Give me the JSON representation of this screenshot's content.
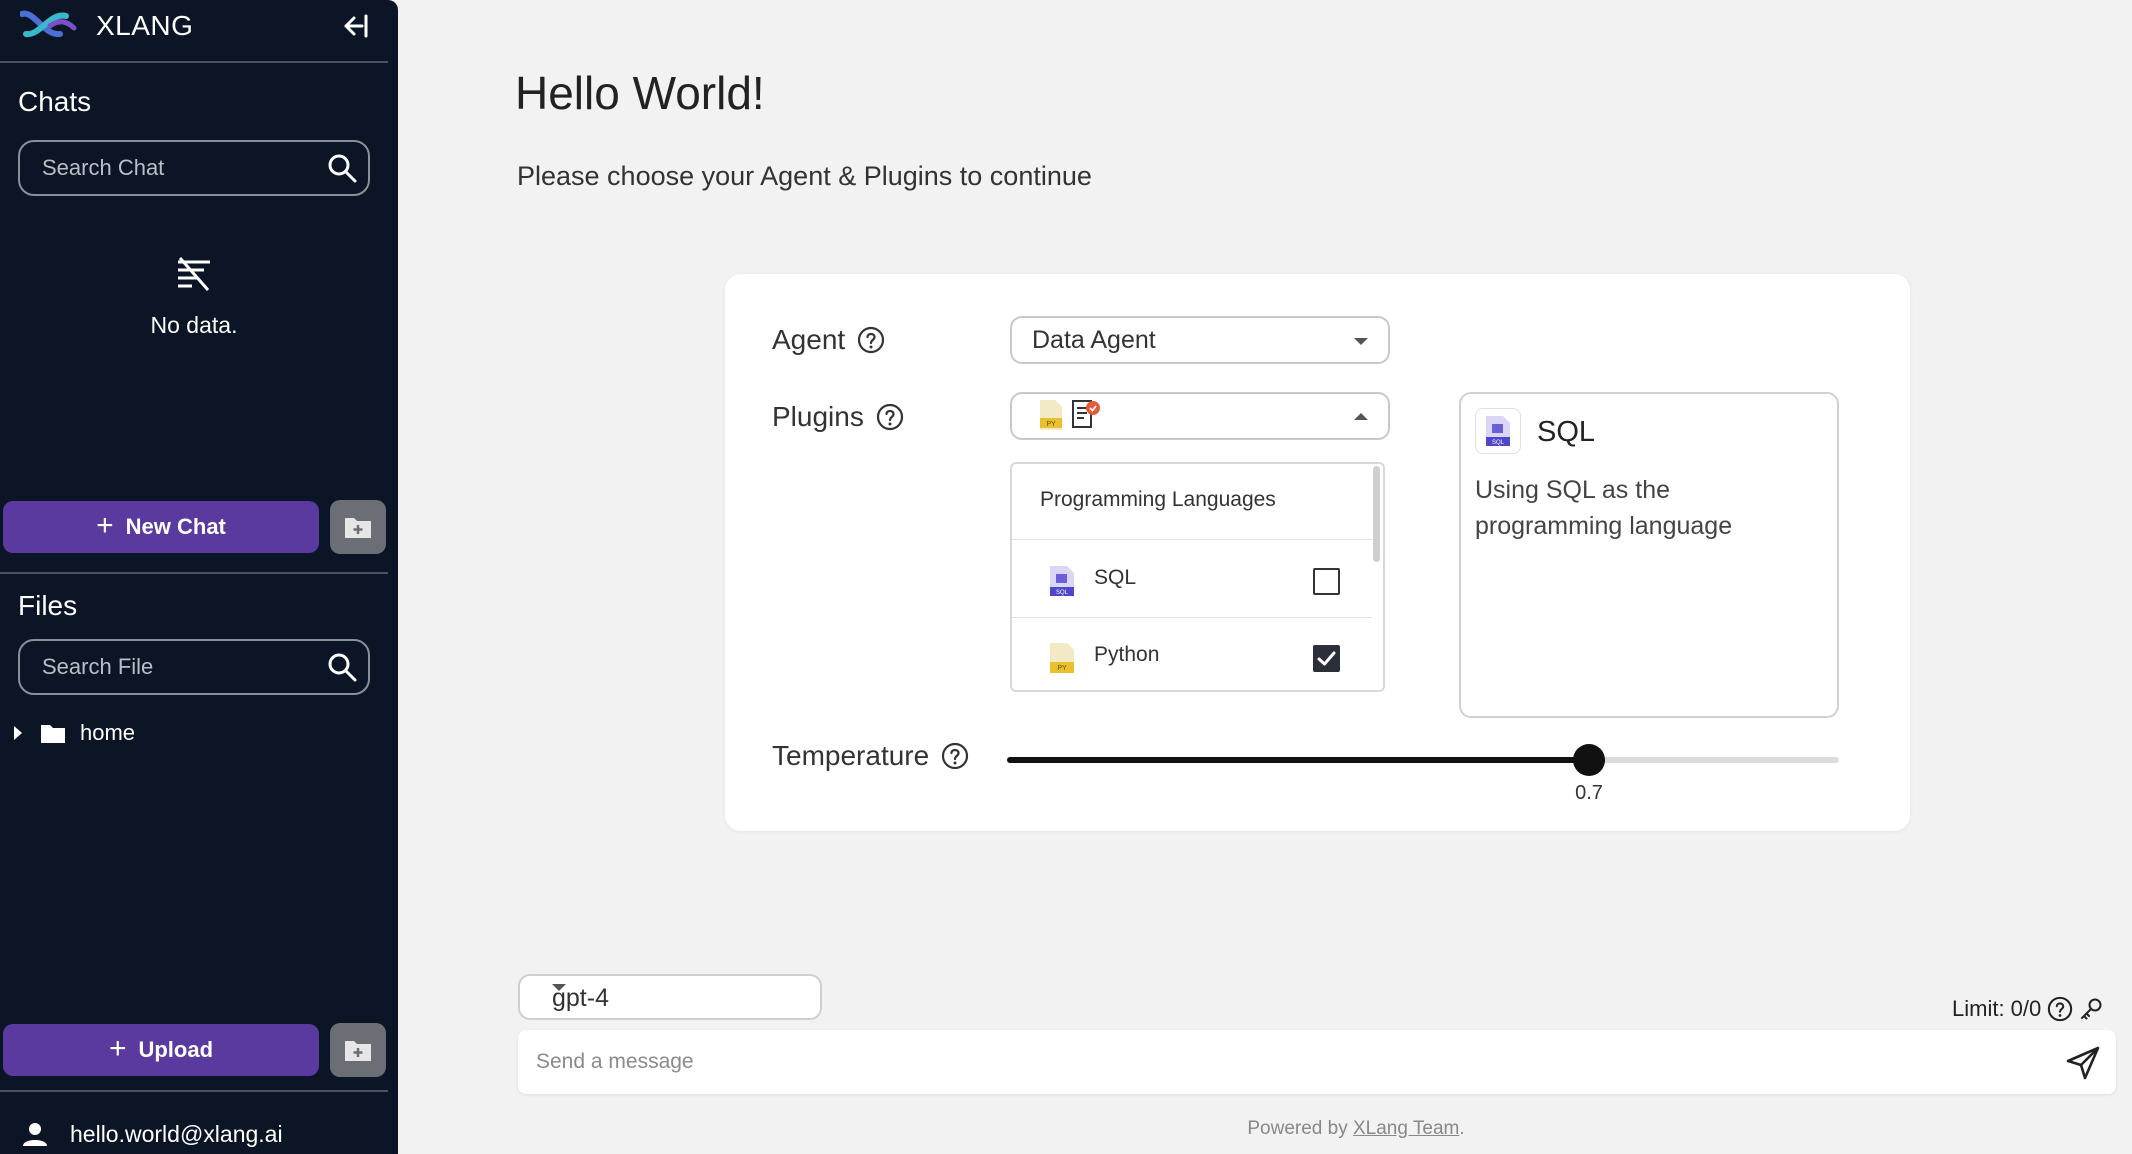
{
  "sidebar": {
    "brand": "XLANG",
    "chats_title": "Chats",
    "search_chat_placeholder": "Search Chat",
    "empty_text": "No data.",
    "new_chat_label": "New Chat",
    "files_title": "Files",
    "search_file_placeholder": "Search File",
    "folder": "home",
    "upload_label": "Upload",
    "user_email": "hello.world@xlang.ai"
  },
  "main": {
    "title": "Hello World!",
    "subtitle": "Please choose your Agent & Plugins to continue"
  },
  "config": {
    "agent_label": "Agent",
    "agent_value": "Data Agent",
    "plugins_label": "Plugins",
    "plugins_group": "Programming Languages",
    "options": [
      {
        "label": "SQL",
        "checked": false,
        "icon": "sql-file-icon"
      },
      {
        "label": "Python",
        "checked": true,
        "icon": "python-file-icon"
      }
    ],
    "detail_title": "SQL",
    "detail_desc": "Using SQL as the programming language",
    "temperature_label": "Temperature",
    "temperature_value": "0.7",
    "temperature_fraction": 0.7
  },
  "composer": {
    "model": "gpt-4",
    "limit": "Limit: 0/0",
    "placeholder": "Send a message"
  },
  "footer": {
    "prefix": "Powered by",
    "link": "XLang Team",
    "suffix": "."
  },
  "colors": {
    "sidebar_bg": "#0c1525",
    "primary_button": "#5a3a9e",
    "page_bg": "#f2f2f2"
  }
}
